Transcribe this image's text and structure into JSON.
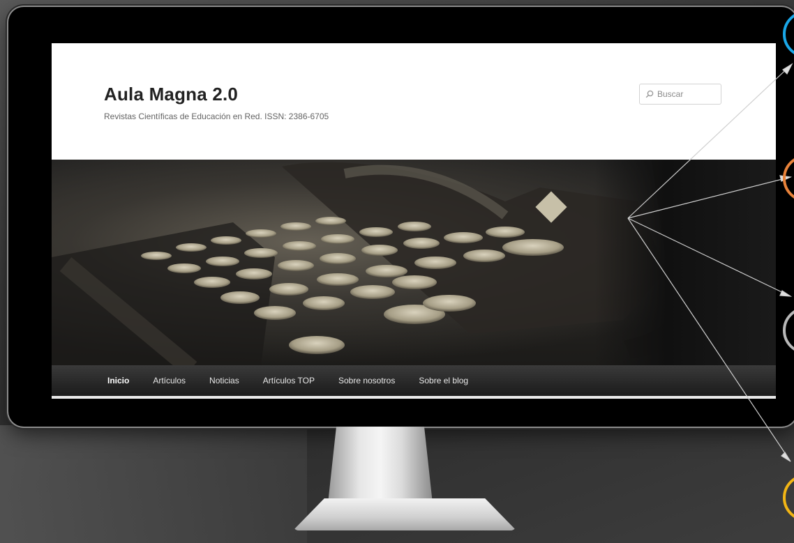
{
  "site": {
    "title": "Aula Magna 2.0",
    "description": "Revistas Científicas de Educación en Red. ISSN: 2386-6705"
  },
  "search": {
    "placeholder": "Buscar",
    "icon": "search-icon"
  },
  "nav": {
    "items": [
      {
        "label": "Inicio",
        "active": true
      },
      {
        "label": "Artículos",
        "active": false
      },
      {
        "label": "Noticias",
        "active": false
      },
      {
        "label": "Artículos TOP",
        "active": false
      },
      {
        "label": "Sobre nosotros",
        "active": false
      },
      {
        "label": "Sobre el blog",
        "active": false
      }
    ]
  },
  "annotations": {
    "circle_colors": [
      "#1aa7e8",
      "#e8823a",
      "#b8b8b8",
      "#f2b515"
    ]
  }
}
